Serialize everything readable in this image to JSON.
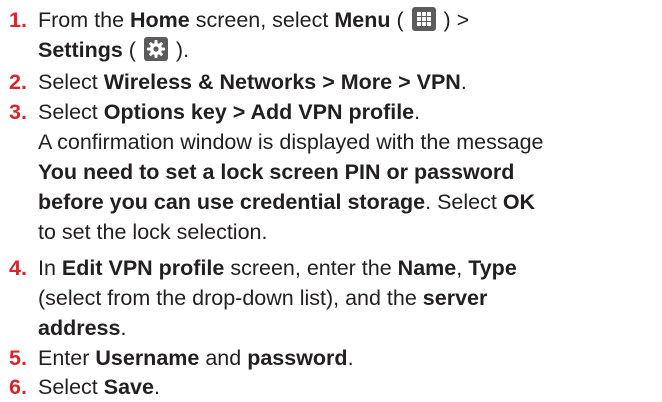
{
  "steps": [
    {
      "number": "1.",
      "lines": [
        [
          "From the ",
          "Home",
          " screen, select ",
          "Menu",
          " ( ",
          " ) >"
        ],
        [
          "Settings",
          " ( ",
          " )."
        ]
      ]
    },
    {
      "number": "2.",
      "lines": [
        [
          "Select ",
          "Wireless & Networks > More > VPN",
          "."
        ]
      ]
    },
    {
      "number": "3.",
      "lines": [
        [
          "Select ",
          "Options key > Add VPN profile",
          "."
        ],
        [
          "A confirmation window is displayed with the message"
        ],
        [
          "You need to set a lock screen PIN or password"
        ],
        [
          "before you can use credential storage",
          ". Select ",
          "OK"
        ],
        [
          "to set the lock selection."
        ]
      ]
    },
    {
      "number": "4.",
      "lines": [
        [
          "In ",
          "Edit VPN profile",
          " screen, enter the ",
          "Name",
          ", ",
          "Type"
        ],
        [
          "(select from the drop-down list), and the ",
          "server"
        ],
        [
          "address",
          "."
        ]
      ]
    },
    {
      "number": "5.",
      "lines": [
        [
          "Enter ",
          "Username",
          " and ",
          "password",
          "."
        ]
      ]
    },
    {
      "number": "6.",
      "lines": [
        [
          "Select ",
          "Save",
          "."
        ]
      ]
    }
  ],
  "icons": {
    "menu": "grid-menu-icon",
    "settings": "gear-icon",
    "icon_background": "#5b5b5b",
    "number_color": "#d6262e",
    "text_color": "#231f20"
  }
}
